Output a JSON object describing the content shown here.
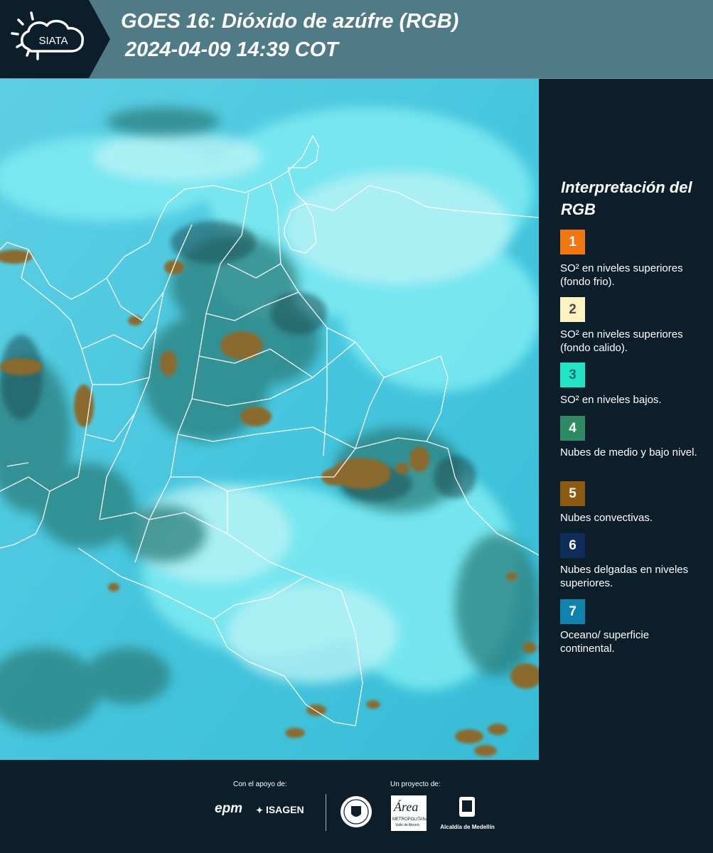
{
  "header": {
    "logo_text": "SIATA",
    "title_line1": "GOES 16: Dióxido de azúfre (RGB)",
    "title_line2": "2024-04-09 14:39 COT",
    "color": "#4f7b87"
  },
  "map": {
    "background_color": "#3ec5df",
    "cloud_colors": [
      "#b7f2f6",
      "#2f7f79",
      "#8a6a2e",
      "#1a4d52"
    ],
    "border_color": "#ffffff"
  },
  "legend": {
    "title": "Interpretación del RGB",
    "items": [
      {
        "number": "1",
        "label": "SO² en niveles superiores (fondo frio).",
        "color": "#f0760f"
      },
      {
        "number": "2",
        "label": "SO² en niveles superiores (fondo calido).",
        "color": "#fbf3c0"
      },
      {
        "number": "3",
        "label": "SO² en niveles bajos.",
        "color": "#22e3c6"
      },
      {
        "number": "4",
        "label": "Nubes de medio y bajo nivel.",
        "color": "#2e8a63"
      },
      {
        "number": "5",
        "label": "Nubes convectivas.",
        "color": "#8b5a10"
      },
      {
        "number": "6",
        "label": "Nubes delgadas en niveles superiores.",
        "color": "#0e2d5b"
      },
      {
        "number": "7",
        "label": "Oceano/ superficie continental.",
        "color": "#0f82ae"
      }
    ]
  },
  "footer": {
    "support_label": "Con el apoyo de:",
    "project_label": "Un proyecto de:",
    "sponsor_epm": "epm",
    "sponsor_isagen": "ISAGEN",
    "partner_area": "Área",
    "partner_area_sub": "METROPOLITANA",
    "partner_area_sub2": "Valle de Aburrá",
    "partner_alcaldia": "Alcaldía de Medellín"
  }
}
